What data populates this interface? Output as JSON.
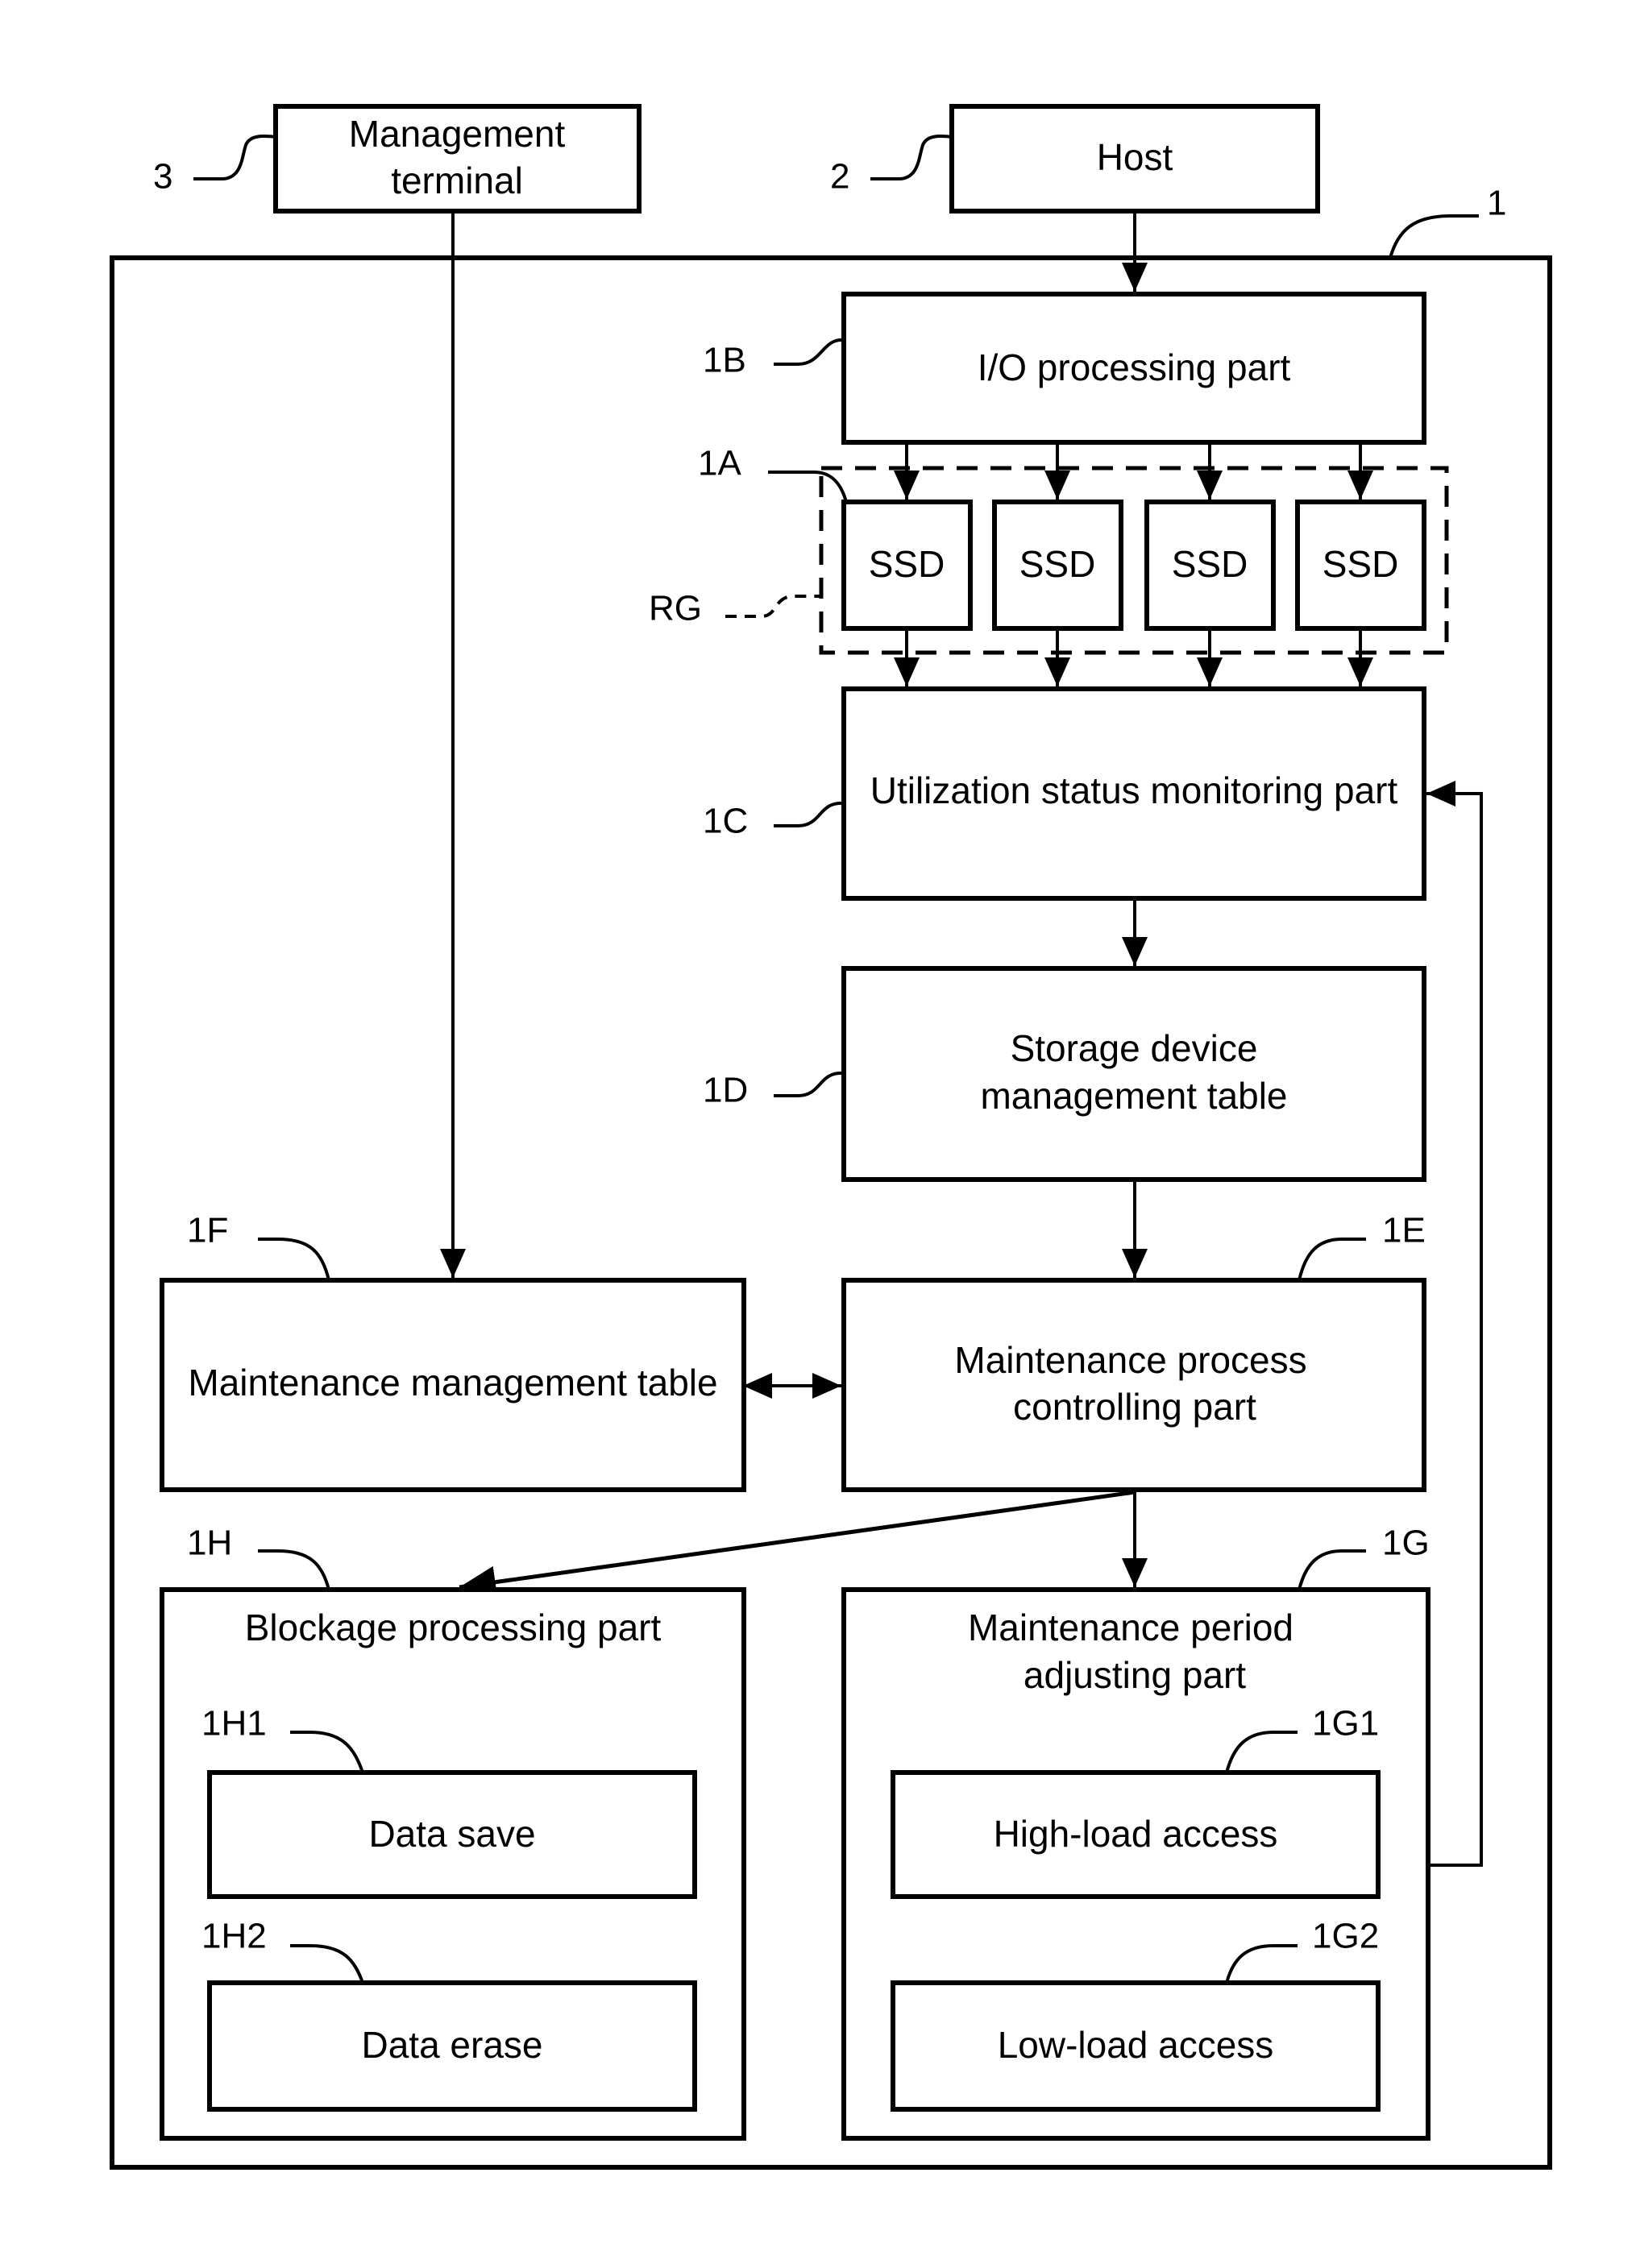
{
  "diagram": {
    "system_ref": "1",
    "nodes": {
      "management_terminal": {
        "ref": "3",
        "lines": [
          "Management",
          "terminal"
        ]
      },
      "host": {
        "ref": "2",
        "lines": [
          "Host"
        ]
      },
      "io_processing": {
        "ref": "1B",
        "lines": [
          "I/O processing part"
        ]
      },
      "ssd_group": {
        "ref": "RG",
        "ssd_ref": "1A",
        "ssds": [
          "SSD",
          "SSD",
          "SSD",
          "SSD"
        ]
      },
      "utilization_monitor": {
        "ref": "1C",
        "lines": [
          "Utilization status monitoring part"
        ]
      },
      "storage_device_table": {
        "ref": "1D",
        "lines": [
          "Storage device",
          "management table"
        ]
      },
      "maintenance_table": {
        "ref": "1F",
        "lines": [
          "Maintenance management table"
        ]
      },
      "maintenance_controller": {
        "ref": "1E",
        "lines": [
          "Maintenance process",
          "controlling part"
        ]
      },
      "blockage_processing": {
        "ref": "1H",
        "lines": [
          "Blockage processing part"
        ],
        "children": [
          {
            "ref": "1H1",
            "label": "Data save"
          },
          {
            "ref": "1H2",
            "label": "Data erase"
          }
        ]
      },
      "period_adjusting": {
        "ref": "1G",
        "lines": [
          "Maintenance period",
          "adjusting part"
        ],
        "children": [
          {
            "ref": "1G1",
            "label": "High-load access"
          },
          {
            "ref": "1G2",
            "label": "Low-load access"
          }
        ]
      }
    },
    "edges": [
      {
        "from": "host",
        "to": "io_processing"
      },
      {
        "from": "io_processing",
        "to": "ssd_group"
      },
      {
        "from": "ssd_group",
        "to": "utilization_monitor"
      },
      {
        "from": "utilization_monitor",
        "to": "storage_device_table"
      },
      {
        "from": "storage_device_table",
        "to": "maintenance_controller"
      },
      {
        "from": "management_terminal",
        "to": "maintenance_table"
      },
      {
        "from": "maintenance_table",
        "to": "maintenance_controller",
        "bidirectional": true
      },
      {
        "from": "maintenance_controller",
        "to": "blockage_processing"
      },
      {
        "from": "maintenance_controller",
        "to": "period_adjusting"
      },
      {
        "from": "period_adjusting",
        "to": "utilization_monitor"
      }
    ]
  }
}
